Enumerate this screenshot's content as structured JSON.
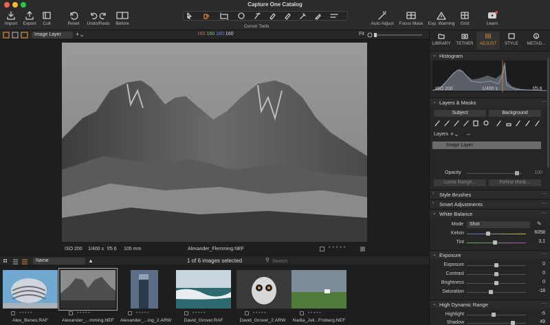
{
  "window": {
    "title": "Capture One Catalog"
  },
  "toolbar": {
    "import": "Import",
    "export": "Export",
    "cull": "Cull",
    "reset": "Reset",
    "undo_redo": "Undo/Redo",
    "before": "Before",
    "cursor_tools": "Cursor Tools",
    "auto_adjust": "Auto Adjust",
    "focus_mask": "Focus Mask",
    "exp_warning": "Exp. Warning",
    "grid": "Grid",
    "learn": "Learn"
  },
  "viewer": {
    "layer_select": "Image Layer",
    "rgb": {
      "r": "160",
      "g": "160",
      "b": "160",
      "a": "160"
    },
    "fit": "Fit",
    "info": {
      "iso": "ISO 200",
      "shutter": "1/400 s",
      "aperture": "f/5.6",
      "focal": "105 mm",
      "filename": "Alexander_Flemming.NEF"
    }
  },
  "browser": {
    "sort": "Name",
    "count": "1 of 6 images selected",
    "search_placeholder": "Search",
    "thumbs": [
      {
        "name": "Alex_Benes.RAF"
      },
      {
        "name": "Alexander_...mming.NEF"
      },
      {
        "name": "Alexander_...ing_2.ARW"
      },
      {
        "name": "David_Grover.RAF"
      },
      {
        "name": "David_Grover_2.ARW"
      },
      {
        "name": "Nadia_Juli...Froberg.NEF"
      }
    ]
  },
  "panel": {
    "tabs": [
      "LIBRARY",
      "TETHER",
      "ADJUST",
      "STYLE",
      "METAD..."
    ],
    "histogram": {
      "title": "Histogram",
      "iso": "ISO 200",
      "shutter": "1/400 s",
      "aperture": "f/5.6"
    },
    "layers_masks": {
      "title": "Layers & Masks",
      "subject": "Subject",
      "background": "Background",
      "layers_label": "Layers",
      "image_layer": "Image Layer",
      "opacity_label": "Opacity",
      "opacity_value": "100",
      "luma_range": "Luma Range...",
      "refine_mask": "Refine Mask..."
    },
    "style_brushes": "Style Brushes",
    "smart_adjustments": "Smart Adjustments",
    "white_balance": {
      "title": "White Balance",
      "mode_label": "Mode",
      "mode_value": "Shot",
      "kelvin_label": "Kelvin",
      "kelvin_value": "6058",
      "tint_label": "Tint",
      "tint_value": "3,1"
    },
    "exposure": {
      "title": "Exposure",
      "rows": [
        {
          "label": "Exposure",
          "value": "0"
        },
        {
          "label": "Contrast",
          "value": "0"
        },
        {
          "label": "Brightness",
          "value": "0"
        },
        {
          "label": "Saturation",
          "value": "-18"
        }
      ]
    },
    "hdr": {
      "title": "High Dynamic Range",
      "rows": [
        {
          "label": "Highlight",
          "value": "-5"
        },
        {
          "label": "Shadow",
          "value": "49"
        }
      ]
    }
  },
  "colors": {
    "accent": "#e08a3a",
    "red": "#e06060",
    "green": "#7ccf5a",
    "blue": "#6a8cff"
  }
}
